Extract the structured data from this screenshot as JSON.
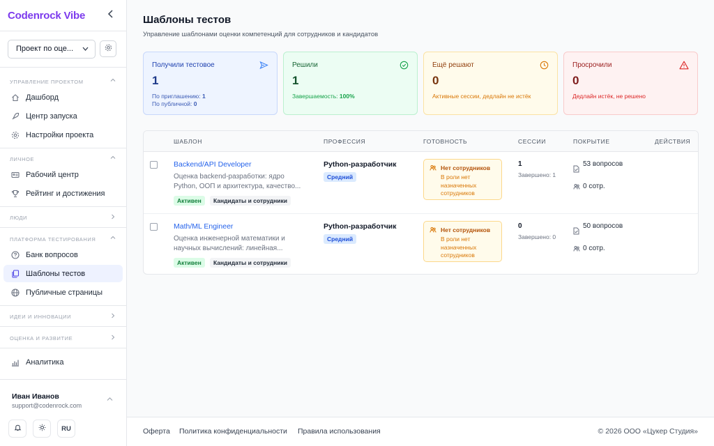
{
  "brand": "Codenrock Vibe",
  "sidebar": {
    "project_select": "Проект по оце...",
    "sections": [
      {
        "title": "Управление проектом"
      },
      {
        "title": "Личное"
      },
      {
        "title": "Люди"
      },
      {
        "title": "Платформа тестирования"
      },
      {
        "title": "Идеи и инновации"
      },
      {
        "title": "Оценка и развитие"
      }
    ],
    "items": [
      {
        "label": "Дашборд",
        "icon": "home-icon"
      },
      {
        "label": "Центр запуска",
        "icon": "rocket-icon"
      },
      {
        "label": "Настройки проекта",
        "icon": "gear-icon"
      },
      {
        "label": "Рабочий центр",
        "icon": "id-card-icon"
      },
      {
        "label": "Рейтинг и достижения",
        "icon": "trophy-icon"
      },
      {
        "label": "Банк вопросов",
        "icon": "question-icon"
      },
      {
        "label": "Шаблоны тестов",
        "icon": "copy-icon"
      },
      {
        "label": "Публичные страницы",
        "icon": "globe-icon"
      },
      {
        "label": "Аналитика",
        "icon": "bar-chart-icon"
      }
    ],
    "user": {
      "name": "Иван Иванов",
      "email": "support@codenrock.com"
    },
    "lang": "RU"
  },
  "header": {
    "title": "Шаблоны тестов",
    "subtitle": "Управление шаблонами оценки компетенций для сотрудников и кандидатов"
  },
  "stats": {
    "received": {
      "label": "Получили тестовое",
      "value": "1",
      "note1_label": "По приглашению:",
      "note1_value": "1",
      "note2_label": "По публичной:",
      "note2_value": "0",
      "color": "#3b82f6"
    },
    "solved": {
      "label": "Решили",
      "value": "1",
      "note_label": "Завершаемость:",
      "note_value": "100%",
      "color": "#16a34a"
    },
    "solving": {
      "label": "Ещё решают",
      "value": "0",
      "note": "Активные сессии, дедлайн не истёк",
      "color": "#d97706"
    },
    "overdue": {
      "label": "Просрочили",
      "value": "0",
      "note": "Дедлайн истёк, не решено",
      "color": "#dc2626"
    }
  },
  "table": {
    "columns": [
      "Шаблон",
      "Профессия",
      "Готовность",
      "Сессии",
      "Покрытие",
      "Действия"
    ],
    "rows": [
      {
        "title": "Backend/API Developer",
        "desc_line1": "Оценка backend-разработки: ядро",
        "desc_line2": "Python, ООП и архитектура, качество...",
        "status": "Активен",
        "audience": "Кандидаты и сотрудники",
        "profession": "Python-разработчик",
        "level": "Средний",
        "ready_title": "Нет сотрудников",
        "ready_desc": "В роли нет назначенных сотрудников",
        "sessions": "1",
        "sessions_done": "Завершено: 1",
        "questions": "53 вопросов",
        "employees": "0 сотр."
      },
      {
        "title": "Math/ML Engineer",
        "desc_line1": "Оценка инженерной математики и",
        "desc_line2": "научных вычислений: линейная...",
        "status": "Активен",
        "audience": "Кандидаты и сотрудники",
        "profession": "Python-разработчик",
        "level": "Средний",
        "ready_title": "Нет сотрудников",
        "ready_desc": "В роли нет назначенных сотрудников",
        "sessions": "0",
        "sessions_done": "Завершено: 0",
        "questions": "50 вопросов",
        "employees": "0 сотр."
      }
    ]
  },
  "footer": {
    "links": [
      "Оферта",
      "Политика конфиденциальности",
      "Правила использования"
    ],
    "copyright": "© 2026 ООО «Цукер Студия»"
  }
}
